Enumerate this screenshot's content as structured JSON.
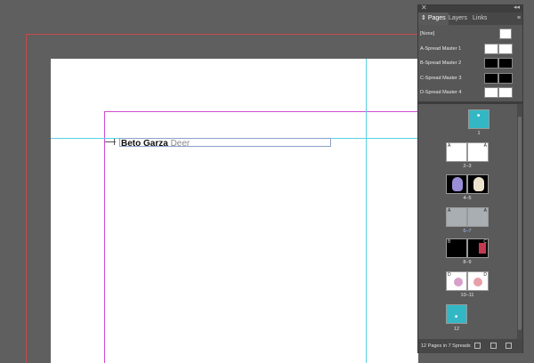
{
  "document": {
    "headline_bold": "Beto Garza",
    "headline_light": "Deer"
  },
  "panel": {
    "tabs": [
      {
        "label": "Pages",
        "active": true
      },
      {
        "label": "Layers",
        "active": false
      },
      {
        "label": "Links",
        "active": false
      }
    ],
    "masters": [
      {
        "label": "[None]"
      },
      {
        "label": "A-Spread Master 1"
      },
      {
        "label": "B-Spread Master 2"
      },
      {
        "label": "C-Spread Master 3"
      },
      {
        "label": "D-Spread Master 4"
      }
    ],
    "spreads": [
      {
        "label": "1"
      },
      {
        "label": "2–3"
      },
      {
        "label": "4–5"
      },
      {
        "label": "6–7"
      },
      {
        "label": "8–9"
      },
      {
        "label": "10–11"
      },
      {
        "label": "12"
      }
    ],
    "master_badges": [
      "A",
      "A",
      "A",
      "A",
      "B",
      "C",
      "D",
      "D"
    ],
    "footer": "12 Pages in 7 Spreads"
  },
  "colors": {
    "bleed": "#c84a4a",
    "margin": "#d14bd1",
    "guide": "#59d3e0",
    "page_cyan": "#33b7c4"
  }
}
